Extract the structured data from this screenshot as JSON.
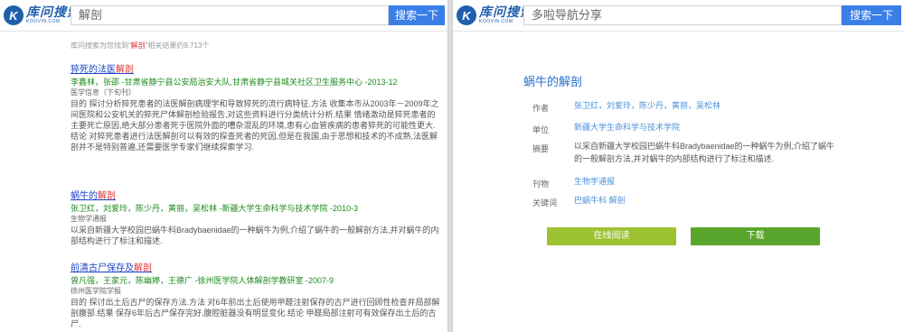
{
  "left": {
    "logo_cn": "库问搜索",
    "logo_en": "KOOVIN.COM",
    "search_value": "解剖",
    "search_button": "搜索一下",
    "summary": {
      "prefix": "库问搜索为您找到“",
      "keyword": "解剖",
      "suffix": "”相关结果约9,713个"
    },
    "results": [
      {
        "title_pre": "猝死的法医",
        "title_hl": "解剖",
        "title_post": "",
        "authors": "李鑫林，张邵 -甘肃省静宁县公安局治安大队,甘肃省静宁县城关社区卫生服务中心 -2013-12",
        "source": "医学信息（下旬刊）",
        "abstract": "目的 探讨分析猝死患者的法医解剖病理学和导致猝死的流行病特征.方法 收集本市从2003年－2009年之间医院和公安机关的猝死尸体解剖检验报告,对这些资料进行分类统计分析.结果 情绪激动是猝死患者的主要死亡原因,绝大部分患者死于医院外面的嘈杂混乱的环境,患有心血管疾病的患者猝死的可能性更大.结论 对猝死患者进行法医解剖可以有效的探查死者的死因,但是在我国,由于思想和技术的不成熟,法医解剖并不是特别普遍,还需要医学专家们继续探索学习."
      },
      {
        "title_pre": "蜗牛的",
        "title_hl": "解剖",
        "title_post": "",
        "authors": "张卫红，刘爱玲，陈少丹，黄丽，吴松林 -新疆大学生命科学与技术学院 -2010-3",
        "source": "生物学通报",
        "abstract": "以采自新疆大学校园巴蜗牛科Bradybaenidae的一种蜗牛为例,介绍了蜗牛的一般解剖方法,并对蜗牛的内部结构进行了标注和描述."
      },
      {
        "title_pre": "前清古尸保存及",
        "title_hl": "解剖",
        "title_post": "",
        "authors": "曾凡强，王家元，陈幽婷，王德广 -徐州医学院人体解剖学教研室 -2007-9",
        "source": "徐州医学院学报",
        "abstract": "目的 探讨出土后古尸的保存方法.方法 对6年前出土后使用甲醛注射保存的古尸进行回顾性检查并局部解剖腹部.结果 保存6年后古尸保存完好,腹腔脏器没有明显变化.结论 甲醛局部注射可有效保存出土后的古尸."
      }
    ]
  },
  "right": {
    "logo_cn": "库问搜索",
    "logo_en": "KOOVIN.COM",
    "search_value": "多啦导航分享",
    "search_button": "搜索一下",
    "title": "蜗牛的解剖",
    "fields": {
      "author_label": "作者",
      "author_value": "张卫红，刘爱玲，陈少丹，黄丽，吴松林",
      "unit_label": "单位",
      "unit_value": "新疆大学生命科学与技术学院",
      "abstract_label": "摘要",
      "abstract_value": "以采自新疆大学校园巴蜗牛科Bradybaenidae的一种蜗牛为例,介绍了蜗牛的一般解剖方法,并对蜗牛的内部结构进行了标注和描述.",
      "journal_label": "刊物",
      "journal_value": "生物学通报",
      "keywords_label": "关键词",
      "keywords_value": "巴蜗牛科 解剖"
    },
    "read_button": "在线阅读",
    "download_button": "下载"
  },
  "colors": {
    "accent": "#3a7ee8",
    "link": "#1a44c8",
    "highlight": "#d33333",
    "author_green": "#1c8a1c",
    "read_button": "#9cc232",
    "download_button": "#5aa62c"
  }
}
